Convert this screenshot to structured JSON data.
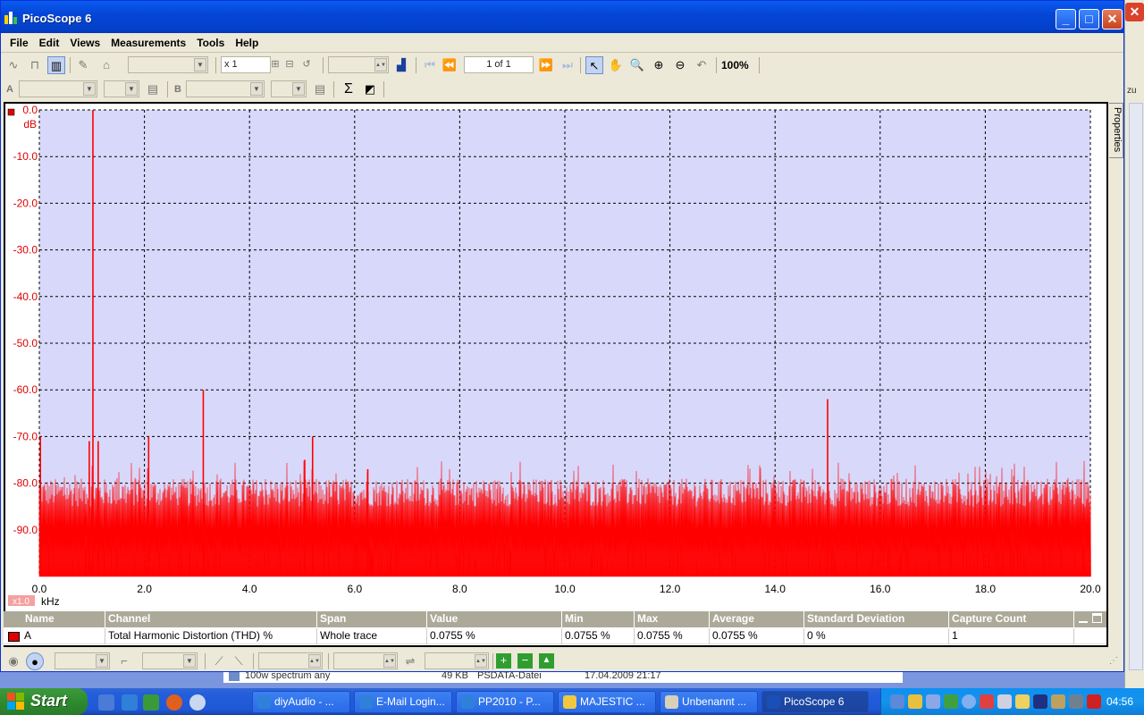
{
  "window": {
    "title": "PicoScope 6"
  },
  "menu": [
    "File",
    "Edit",
    "Views",
    "Measurements",
    "Tools",
    "Help"
  ],
  "toolbar": {
    "zoom_factor": "x 1",
    "page_indicator": "1 of 1",
    "zoom_percent": "100%"
  },
  "channels": {
    "a_label": "A",
    "b_label": "B"
  },
  "properties_tab": "Properties",
  "chart_data": {
    "type": "line",
    "xlabel": "kHz",
    "ylabel": "dB",
    "xlim": [
      0,
      20
    ],
    "ylim": [
      -100,
      0
    ],
    "x_ticks": [
      "0.0",
      "2.0",
      "4.0",
      "6.0",
      "8.0",
      "10.0",
      "12.0",
      "14.0",
      "16.0",
      "18.0",
      "20.0"
    ],
    "y_ticks": [
      "0.0",
      "-10.0",
      "-20.0",
      "-30.0",
      "-40.0",
      "-50.0",
      "-60.0",
      "-70.0",
      "-80.0",
      "-90.0"
    ],
    "axis_scale_badge": "x1.0",
    "grid": true,
    "series": [
      {
        "name": "A",
        "color": "#ff0000",
        "noise_floor_db": -88,
        "peaks": [
          {
            "x": 0.02,
            "y": -70
          },
          {
            "x": 0.95,
            "y": -71
          },
          {
            "x": 1.02,
            "y": 0
          },
          {
            "x": 1.12,
            "y": -71
          },
          {
            "x": 2.08,
            "y": -70
          },
          {
            "x": 3.12,
            "y": -60
          },
          {
            "x": 5.05,
            "y": -75
          },
          {
            "x": 5.2,
            "y": -70
          },
          {
            "x": 6.25,
            "y": -77
          },
          {
            "x": 15.0,
            "y": -62
          }
        ]
      }
    ]
  },
  "measurements": {
    "headers": [
      "Name",
      "Channel",
      "Span",
      "Value",
      "Min",
      "Max",
      "Average",
      "Standard Deviation",
      "Capture Count"
    ],
    "rows": [
      [
        "A",
        "Total Harmonic Distortion (THD) %",
        "Whole trace",
        "0.0755 %",
        "0.0755 %",
        "0.0755 %",
        "0.0755 %",
        "0 %",
        "1"
      ]
    ]
  },
  "explorer_row": {
    "name": "100w spectrum any",
    "size": "49 KB",
    "type": "PSDATA-Datei",
    "date": "17.04.2009 21:17"
  },
  "background_window": {
    "label": "zu"
  },
  "taskbar": {
    "start": "Start",
    "tasks": [
      "diyAudio - ...",
      "E-Mail Login...",
      "PP2010 - P...",
      "MAJESTIC ...",
      "Unbenannt ...",
      "PicoScope 6"
    ],
    "time": "04:56"
  }
}
